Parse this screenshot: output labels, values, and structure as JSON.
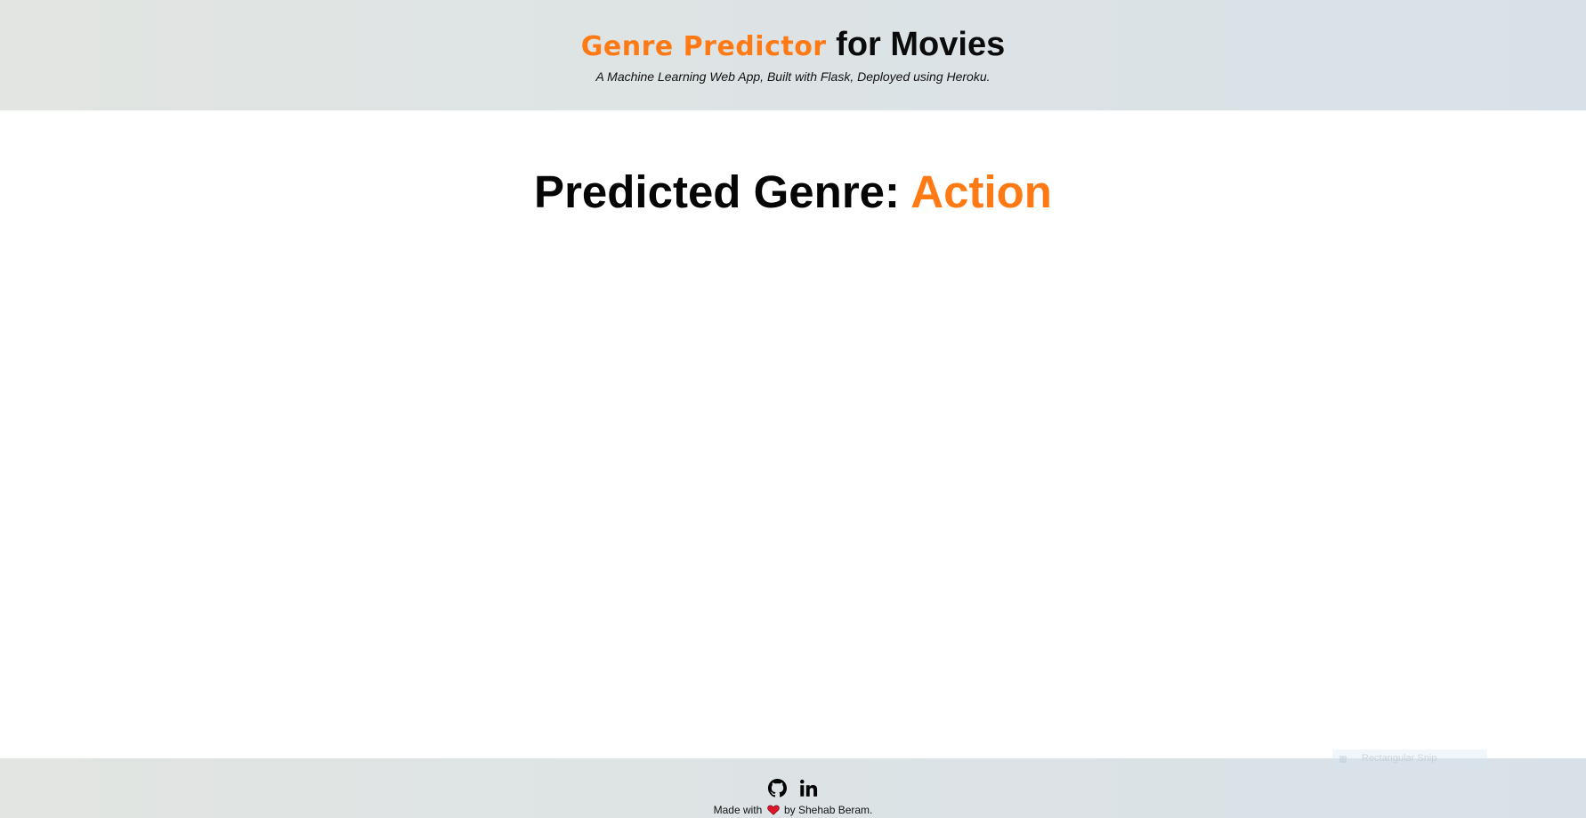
{
  "header": {
    "title_accent": "Genre Predictor",
    "title_rest": "for Movies",
    "subtitle": "A Machine Learning Web App, Built with Flask, Deployed using Heroku."
  },
  "result": {
    "label": "Predicted Genre:",
    "genre": "Action"
  },
  "footer": {
    "icons": [
      "github-icon",
      "linkedin-icon",
      "heart-icon"
    ],
    "credit_prefix": "Made with",
    "credit_suffix": "by Shehab Beram."
  },
  "overlay": {
    "snip_label": "Rectangular Snip"
  },
  "colors": {
    "accent": "#ff7a14",
    "text": "#0b0b0b",
    "heart": "#e0162b"
  }
}
